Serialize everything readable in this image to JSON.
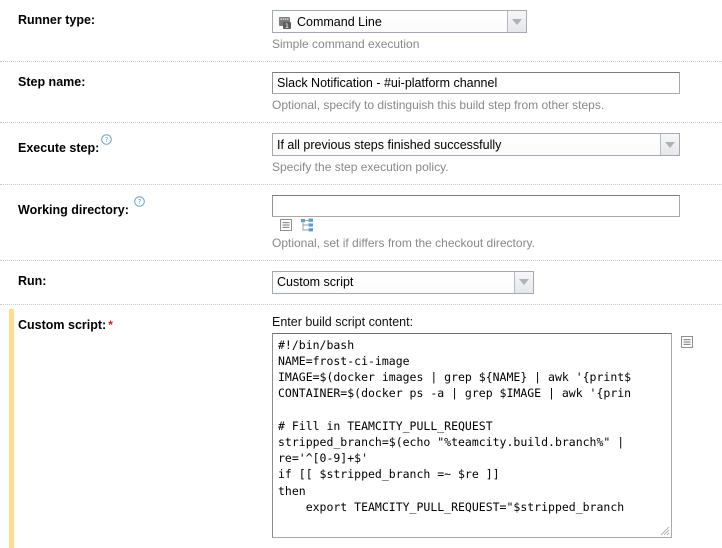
{
  "form": {
    "rows": [
      {
        "label": "Runner type:",
        "value": "Command Line",
        "hint": "Simple command execution"
      },
      {
        "label": "Step name:",
        "value": "Slack Notification - #ui-platform channel",
        "hint": "Optional, specify to distinguish this build step from other steps."
      },
      {
        "label": "Execute step:",
        "value": "If all previous steps finished successfully",
        "hint": "Specify the step execution policy."
      },
      {
        "label": "Working directory:",
        "value": "",
        "placeholder": "",
        "hint": "Optional, set if differs from the checkout directory."
      },
      {
        "label": "Run:",
        "value": "Custom script",
        "hint": ""
      }
    ]
  },
  "custom_script": {
    "label": "Custom script:",
    "required_marker": "*",
    "field_caption": "Enter build script content:",
    "content": "#!/bin/bash\nNAME=frost-ci-image\nIMAGE=$(docker images | grep ${NAME} | awk '{print$\nCONTAINER=$(docker ps -a | grep $IMAGE | awk '{prin\n\n# Fill in TEAMCITY_PULL_REQUEST\nstripped_branch=$(echo \"%teamcity.build.branch%\" |\nre='^[0-9]+$'\nif [[ $stripped_branch =~ $re ]]\nthen\n    export TEAMCITY_PULL_REQUEST=\"$stripped_branch"
  },
  "icons": {
    "help": "help-question-icon",
    "runner_badge": "command-line-runner-icon",
    "dropdown_arrow": "chevron-down-icon",
    "editor": "open-in-editor-icon",
    "tree": "browse-tree-icon",
    "resize": "resize-grip-icon"
  },
  "colors": {
    "accent_bar": "#fbdf8e",
    "required": "#cc2222",
    "hint_text": "#888888",
    "help_icon": "#6aa3d5"
  }
}
